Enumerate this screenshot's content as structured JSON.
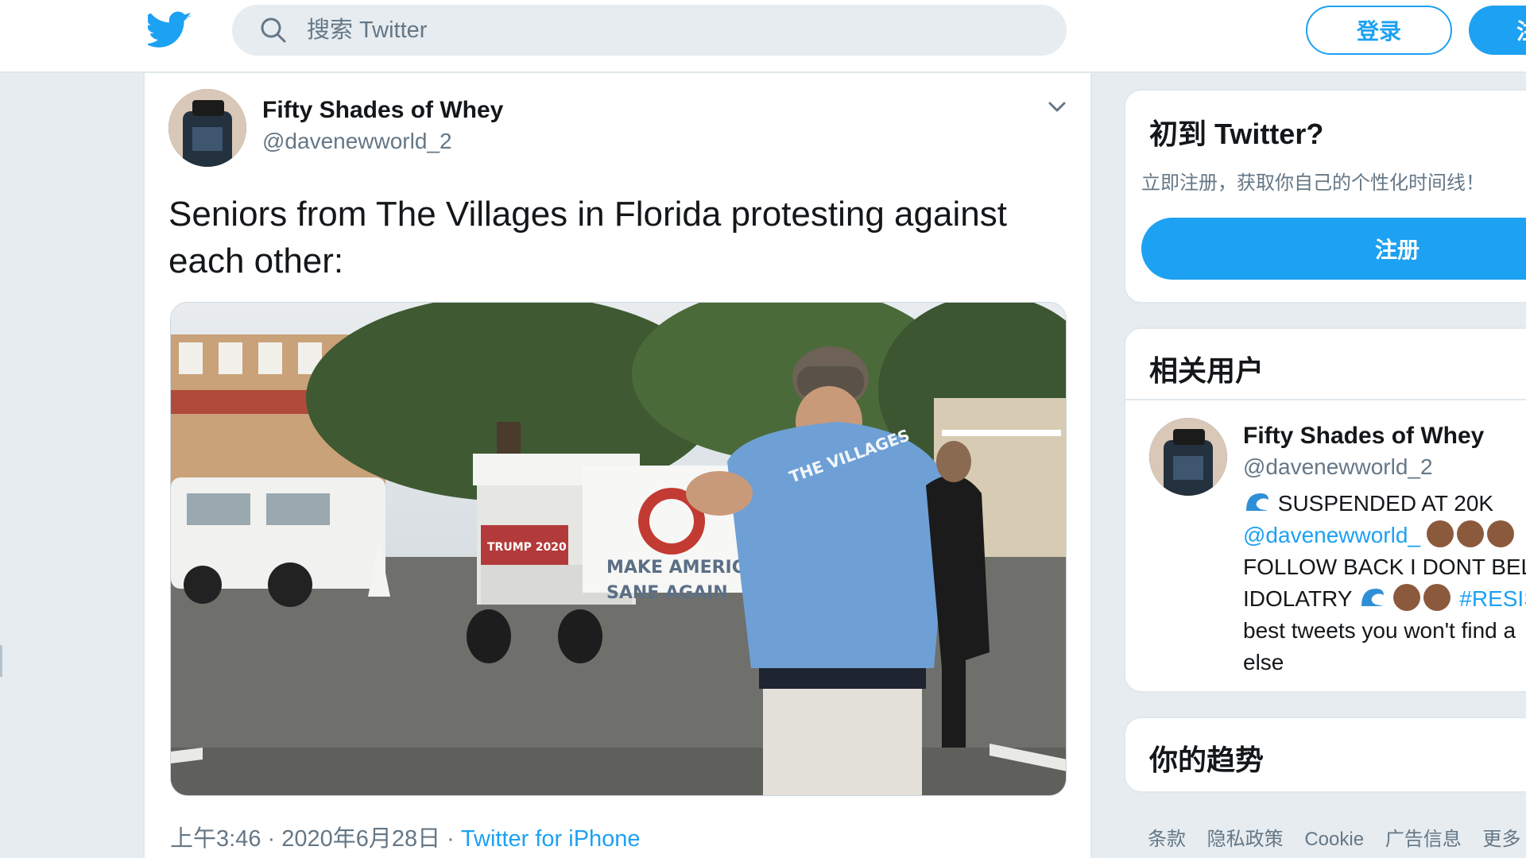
{
  "header": {
    "search_placeholder": "搜索 Twitter",
    "login_label": "登录",
    "signup_label": "注"
  },
  "tweet": {
    "author_name": "Fifty Shades of Whey",
    "author_handle": "@davenewworld_2",
    "text": "Seniors from The Villages in Florida protesting against each other:",
    "timestamp": "上午3:46 · 2020年6月28日 · ",
    "source": "Twitter for iPhone",
    "media_signs": {
      "sign_line1": "MAKE AMERICA",
      "sign_line2": "SANE AGAIN",
      "cart_sign": "TRUMP 2020",
      "shirt_text": "THE VILLAGES"
    }
  },
  "sidebar": {
    "new_to_twitter": {
      "title": "初到 Twitter?",
      "subtitle": "立即注册，获取你自己的个性化时间线！",
      "register_label": "注册"
    },
    "related_users": {
      "title": "相关用户",
      "user": {
        "name": "Fifty Shades of Whey",
        "handle": "@davenewworld_2",
        "bio_line1": "SUSPENDED AT 20K",
        "bio_link": "@davenewworld_",
        "bio_line3": "FOLLOW BACK I DONT BELI",
        "bio_line4_text": "IDOLATRY",
        "bio_hashtag": "#RESIS",
        "bio_line5": "best tweets you won't find a",
        "bio_line6": "else"
      }
    },
    "trends": {
      "title": "你的趋势"
    },
    "footer": [
      "条款",
      "隐私政策",
      "Cookie",
      "广告信息",
      "更多"
    ]
  },
  "colors": {
    "accent": "#1da1f2",
    "background": "#e6ecf0",
    "text_secondary": "#657786"
  }
}
